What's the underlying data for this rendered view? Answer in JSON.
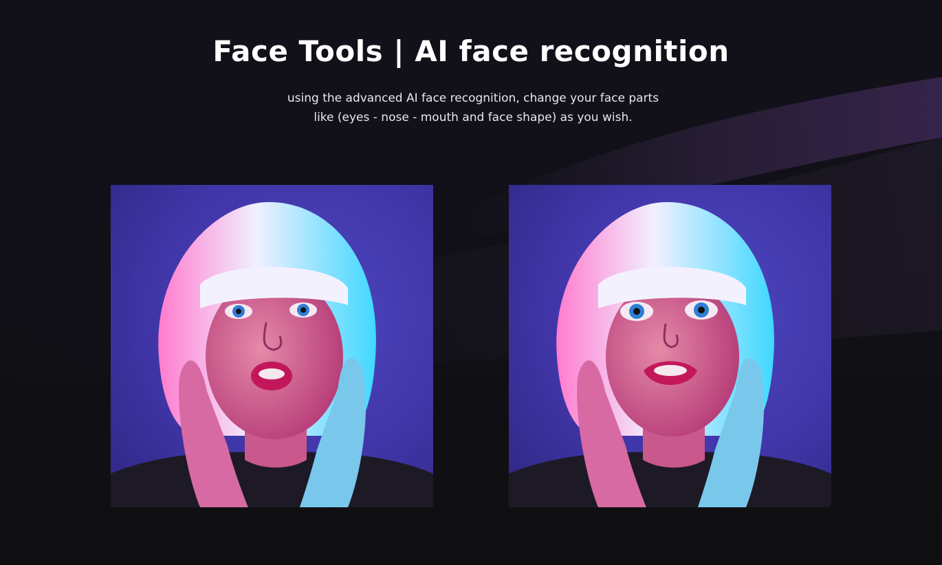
{
  "hero": {
    "title": "Face Tools | AI face recognition",
    "description_line1": "using the advanced AI face recognition, change your face parts",
    "description_line2": "like (eyes - nose - mouth and face shape) as you wish."
  },
  "comparison": {
    "before_image": "portrait-before-image",
    "after_image": "portrait-after-image"
  },
  "colors": {
    "background": "#111017",
    "photo_backdrop": "#4036a8",
    "title_text": "#ffffff"
  }
}
